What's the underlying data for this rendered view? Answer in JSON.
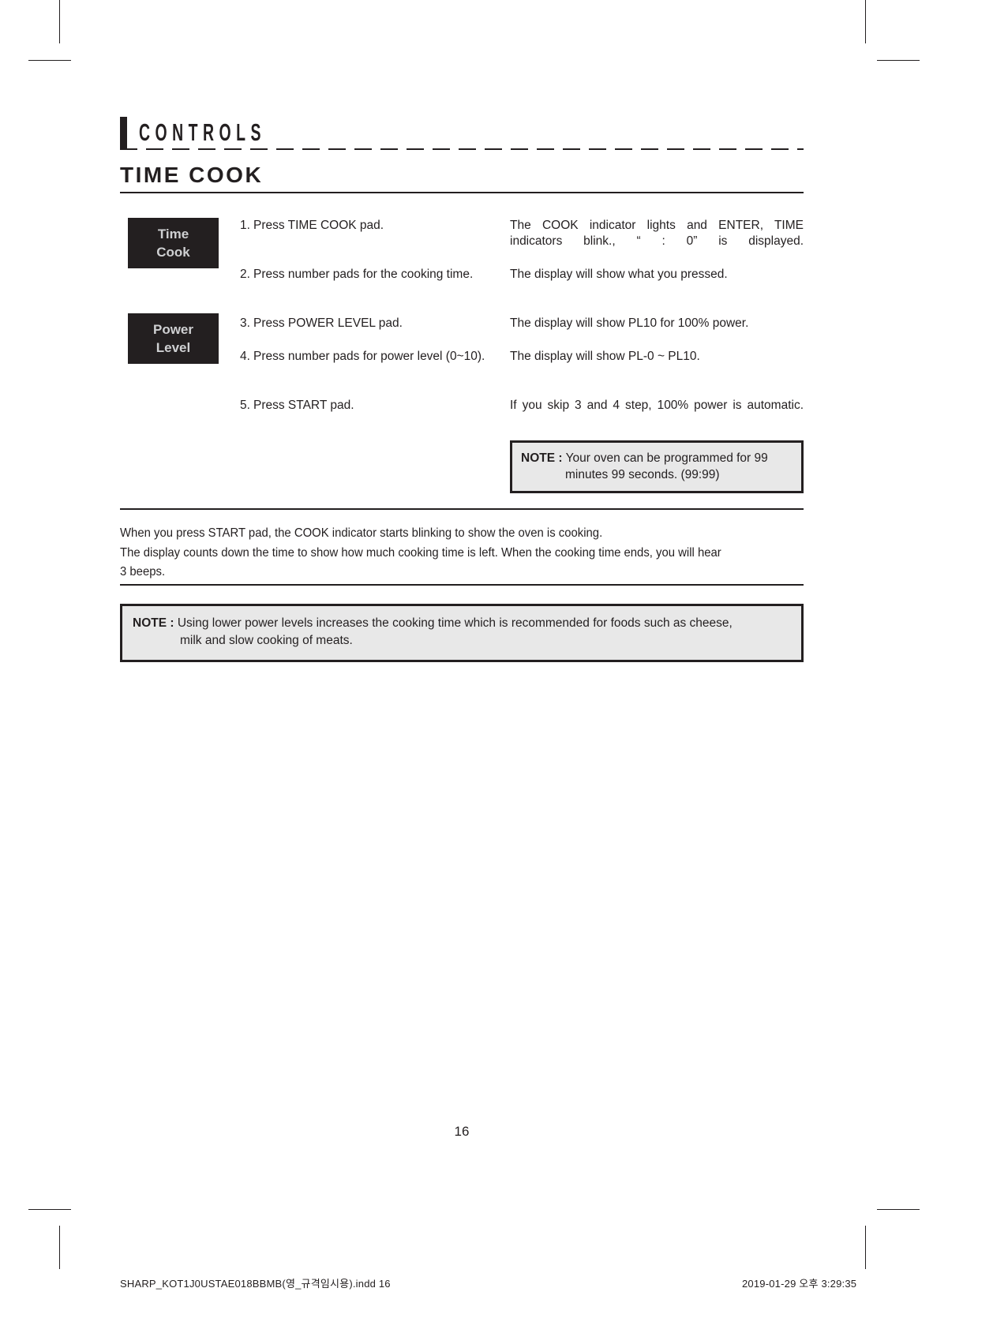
{
  "header": {
    "chapter_label": "CONTROLS",
    "section_title": "TIME COOK"
  },
  "pads": [
    {
      "name": "time-cook-pad",
      "line1": "Time",
      "line2": "Cook"
    },
    {
      "name": "power-level-pad",
      "line1": "Power",
      "line2": "Level"
    }
  ],
  "steps": [
    {
      "number": "1.",
      "text": "Press TIME COOK pad.",
      "response": "The COOK indicator lights and ENTER, TIME indicators blink., “ : 0” is displayed."
    },
    {
      "number": "2.",
      "text": "Press number pads for the cooking time.",
      "response": "The display will show what you pressed."
    },
    {
      "number": "3.",
      "text": "Press POWER LEVEL pad.",
      "response": "The display will show PL10 for 100% power."
    },
    {
      "number": "4.",
      "text": "Press number pads for power level (0~10).",
      "response": "The display will show PL-0 ~ PL10."
    },
    {
      "number": "5.",
      "text": "Press START pad.",
      "response": "If you skip 3 and 4 step, 100% power is automatic."
    }
  ],
  "note_inline": {
    "label": "NOTE :",
    "line1": "Your oven can be programmed for 99",
    "line2": "minutes 99 seconds. (99:99)"
  },
  "body_paragraph": {
    "line1": "When you press START pad, the COOK indicator starts blinking to show the oven is cooking.",
    "line2": "The display counts down the time to show how much cooking time is left. When the cooking time ends, you will hear",
    "line3": "3 beeps."
  },
  "note_bottom": {
    "label": "NOTE :",
    "line1": "Using lower power levels increases the cooking time which is recommended for foods such as cheese,",
    "line2": "milk and slow cooking of meats."
  },
  "page_number": "16",
  "footer": {
    "filename": "SHARP_KOT1J0USTAE018BBMB(영_규격임시용).indd   16",
    "timestamp": "2019-01-29   오후 3:29:35"
  }
}
